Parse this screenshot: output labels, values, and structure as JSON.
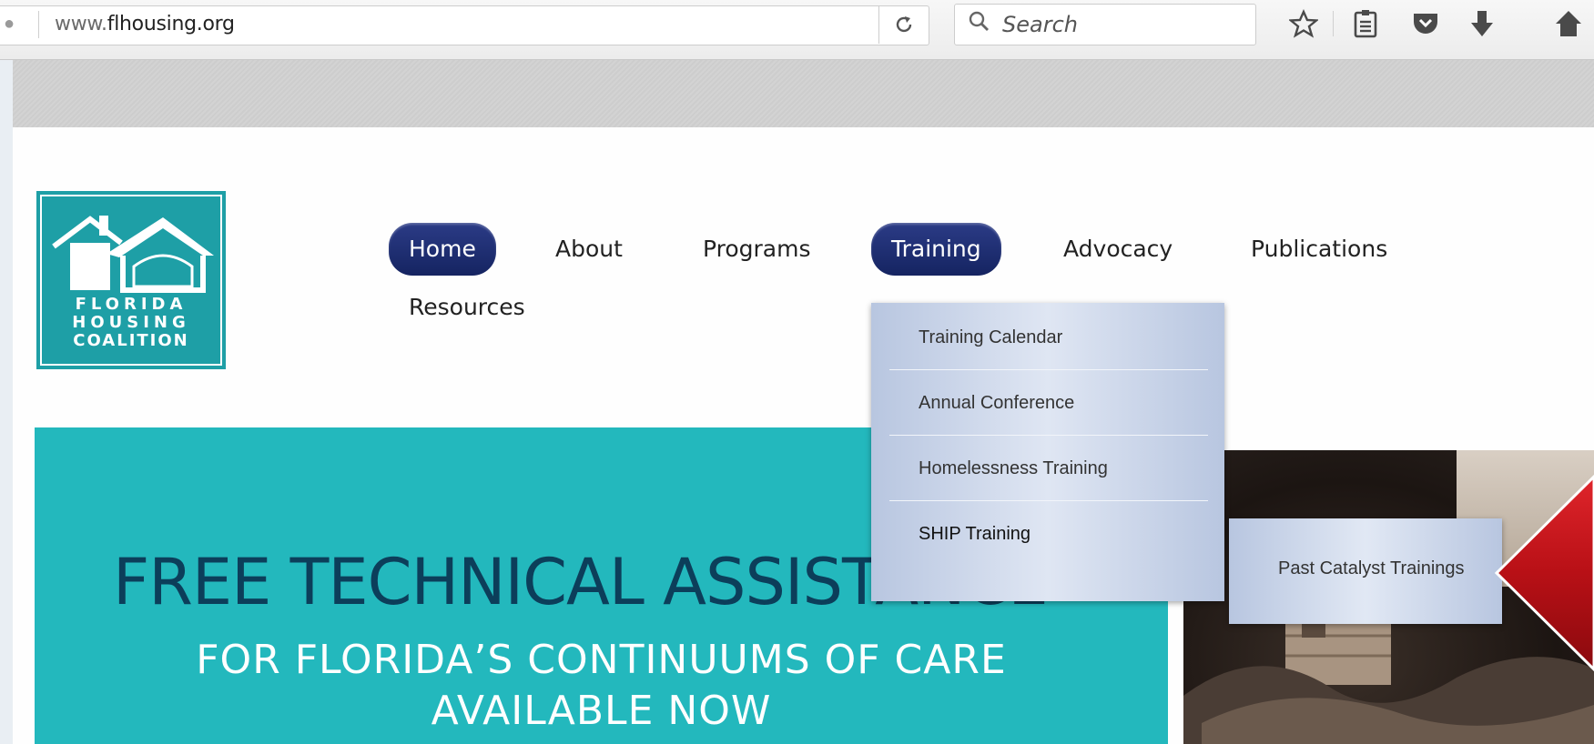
{
  "browser": {
    "url_prefix": "www.",
    "url_domain": "flhousing.org",
    "search_placeholder": "Search"
  },
  "logo": {
    "lines": [
      "FLORIDA",
      "HOUSING",
      "COALITION"
    ],
    "color": "#1e9fa6"
  },
  "nav": {
    "items": [
      {
        "label": "Home",
        "active": true
      },
      {
        "label": "About",
        "active": false
      },
      {
        "label": "Programs",
        "active": false
      },
      {
        "label": "Training",
        "active": true
      },
      {
        "label": "Advocacy",
        "active": false
      },
      {
        "label": "Publications",
        "active": false
      },
      {
        "label": "Resources",
        "active": false
      }
    ],
    "active_color": "#1b2a6b"
  },
  "training_menu": {
    "items": [
      "Training Calendar",
      "Annual Conference",
      "Homelessness Training",
      "SHIP Training"
    ]
  },
  "ship_submenu": {
    "items": [
      "Past Catalyst Trainings"
    ]
  },
  "banner": {
    "headline": "FREE TECHNICAL ASSISTANCE",
    "sub_line_1": "FOR FLORIDA’S CONTINUUMS OF CARE",
    "sub_line_2": "AVAILABLE NOW",
    "background": "#23b8bd",
    "headline_color": "#0c3e5a"
  },
  "annotation": {
    "arrow_color": "#c0161b"
  }
}
